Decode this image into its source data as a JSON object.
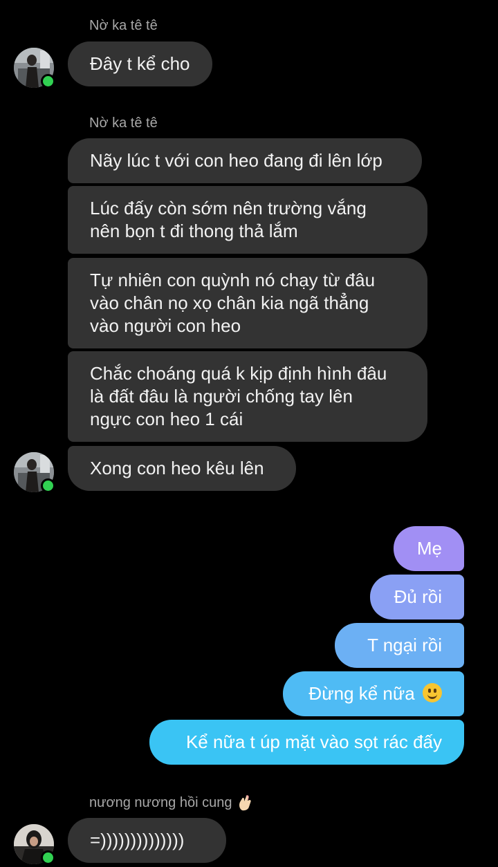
{
  "conversation": {
    "groups": [
      {
        "sender": "Nờ ka tê tê",
        "messages": [
          "Đây t kể cho"
        ]
      },
      {
        "sender": "Nờ ka tê tê",
        "messages": [
          "Nãy lúc t với con heo đang đi lên lớp",
          [
            "Lúc đấy còn sớm nên trường vắng",
            "nên bọn t đi thong thả lắm"
          ],
          [
            "Tự nhiên con quỳnh nó chạy từ đâu",
            "vào chân nọ xọ chân kia ngã thẳng",
            "vào người con heo"
          ],
          [
            "Chắc choáng quá k kịp định hình đâu",
            "là đất đâu là người chống tay lên",
            "ngực con heo 1 cái"
          ],
          "Xong con heo kêu lên"
        ]
      }
    ],
    "outgoing": [
      "Mẹ",
      "Đủ rồi",
      "T ngại rồi",
      "Đừng kể nữa",
      "Kể nữa t úp mặt vào sọt rác đấy"
    ],
    "last_group": {
      "sender": "nương nương hồi cung",
      "sender_emoji": "pinched-fingers-hand-icon",
      "messages": [
        "=))))))))))))))"
      ]
    }
  },
  "icons": {
    "smile_emoji": "slightly-smiling-face-icon",
    "online_indicator": "online-status-dot"
  },
  "colors": {
    "background": "#000000",
    "incoming_bubble": "#333333",
    "outgoing_gradient_top": "#a48cf5",
    "outgoing_gradient_bottom": "#33c3f5",
    "online_dot": "#31d152"
  }
}
